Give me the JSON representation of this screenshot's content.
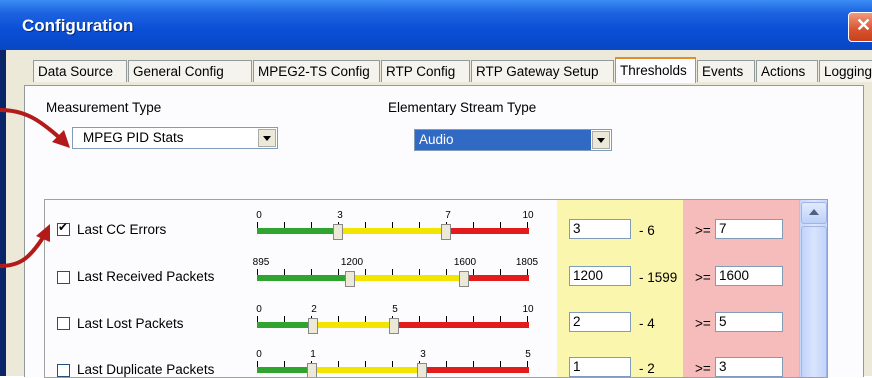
{
  "window": {
    "title": "Configuration",
    "close_symbol": "✕"
  },
  "tabs": [
    "Data Source",
    "General Config",
    "MPEG2-TS Config",
    "RTP Config",
    "RTP Gateway Setup",
    "Thresholds",
    "Events",
    "Actions",
    "Logging"
  ],
  "active_tab": "Thresholds",
  "measurement_type": {
    "label": "Measurement Type",
    "value": "MPEG PID Stats"
  },
  "stream_type": {
    "label": "Elementary Stream Type",
    "value": "Audio"
  },
  "rows": [
    {
      "name": "Last CC Errors",
      "checked": true,
      "ticks": [
        "0",
        "3",
        "7",
        "10"
      ],
      "low": "3",
      "low_to": "- 6",
      "high_prefix": ">=",
      "high": "7"
    },
    {
      "name": "Last Received Packets",
      "checked": false,
      "ticks": [
        "895",
        "1200",
        "1600",
        "1805"
      ],
      "low": "1200",
      "low_to": "- 1599",
      "high_prefix": ">=",
      "high": "1600"
    },
    {
      "name": "Last Lost Packets",
      "checked": false,
      "ticks": [
        "0",
        "2",
        "5",
        "10"
      ],
      "low": "2",
      "low_to": "- 4",
      "high_prefix": ">=",
      "high": "5"
    },
    {
      "name": "Last Duplicate Packets",
      "checked": false,
      "ticks": [
        "0",
        "1",
        "3",
        "5"
      ],
      "low": "1",
      "low_to": "- 2",
      "high_prefix": ">=",
      "high": "3"
    }
  ],
  "colors": {
    "green": "#2fa52f",
    "yellow": "#f2e600",
    "red": "#e21b1b",
    "annotation_arrow": "#b31b1b"
  }
}
